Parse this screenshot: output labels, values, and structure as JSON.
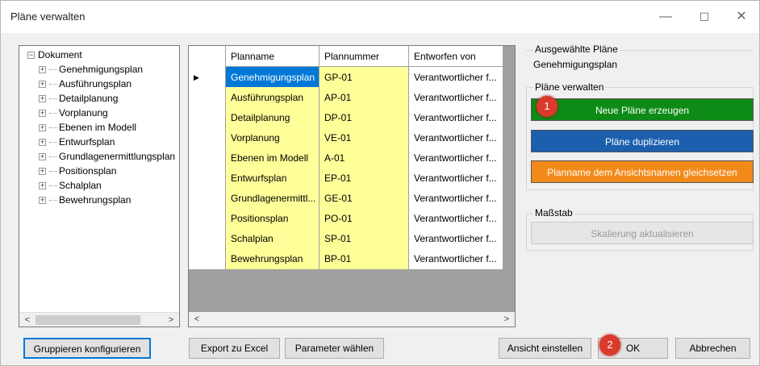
{
  "window": {
    "title": "Pläne verwalten"
  },
  "tree": {
    "root": "Dokument",
    "items": [
      "Genehmigungsplan",
      "Ausführungsplan",
      "Detailplanung",
      "Vorplanung",
      "Ebenen im Modell",
      "Entwurfsplan",
      "Grundlagenermittlungsplan",
      "Positionsplan",
      "Schalplan",
      "Bewehrungsplan"
    ]
  },
  "grid": {
    "columns": [
      "Planname",
      "Plannummer",
      "Entworfen von"
    ],
    "rows": [
      {
        "name": "Genehmigungsplan",
        "number": "GP-01",
        "by": "Verantwortlicher f..."
      },
      {
        "name": "Ausführungsplan",
        "number": "AP-01",
        "by": "Verantwortlicher f..."
      },
      {
        "name": "Detailplanung",
        "number": "DP-01",
        "by": "Verantwortlicher f..."
      },
      {
        "name": "Vorplanung",
        "number": "VE-01",
        "by": "Verantwortlicher f..."
      },
      {
        "name": "Ebenen im Modell",
        "number": "A-01",
        "by": "Verantwortlicher f..."
      },
      {
        "name": "Entwurfsplan",
        "number": "EP-01",
        "by": "Verantwortlicher f..."
      },
      {
        "name": "Grundlagenermittl...",
        "number": "GE-01",
        "by": "Verantwortlicher f..."
      },
      {
        "name": "Positionsplan",
        "number": "PO-01",
        "by": "Verantwortlicher f..."
      },
      {
        "name": "Schalplan",
        "number": "SP-01",
        "by": "Verantwortlicher f..."
      },
      {
        "name": "Bewehrungsplan",
        "number": "BP-01",
        "by": "Verantwortlicher f..."
      }
    ]
  },
  "right": {
    "selected_label": "Ausgewählte Pläne",
    "selected_value": "Genehmigungsplan",
    "manage_label": "Pläne verwalten",
    "new_btn": "Neue Pläne erzeugen",
    "dup_btn": "Pläne duplizieren",
    "equalize_btn": "Planname dem Ansichtsnamen gleichsetzen",
    "scale_label": "Maßstab",
    "scale_btn": "Skalierung aktualisieren"
  },
  "bottom": {
    "group_btn": "Gruppieren konfigurieren",
    "export_btn": "Export zu Excel",
    "params_btn": "Parameter wählen",
    "view_btn": "Ansicht einstellen",
    "ok_btn": "OK",
    "cancel_btn": "Abbrechen"
  },
  "badges": [
    "1",
    "2"
  ],
  "colors": {
    "green": "#0e8a16",
    "blue": "#1c5fae",
    "orange": "#f28a1a",
    "selection": "#0078d7",
    "cell_yellow": "#ffff99"
  }
}
